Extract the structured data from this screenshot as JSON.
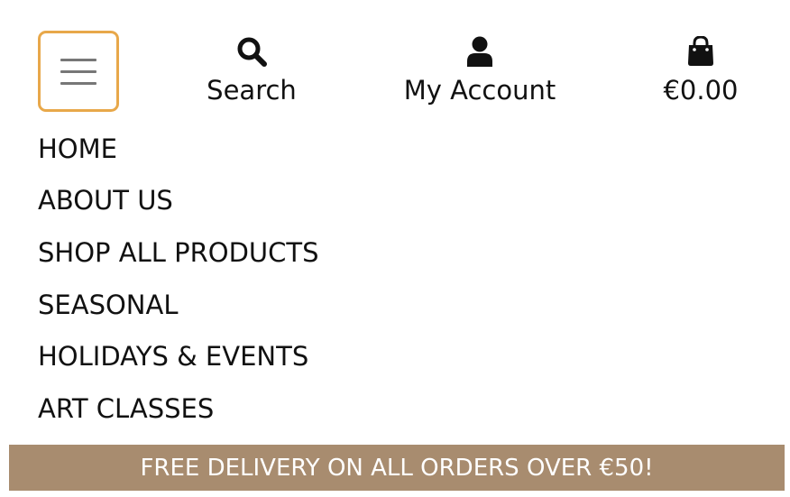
{
  "header": {
    "menu_toggle_icon": "hamburger-icon",
    "accent_color": "#e8a84a",
    "search": {
      "icon": "search-icon",
      "label": "Search"
    },
    "account": {
      "icon": "user-icon",
      "label": "My Account"
    },
    "bag": {
      "icon": "shopping-bag-icon",
      "label": "€0.00"
    }
  },
  "nav": {
    "items": [
      {
        "label": "HOME"
      },
      {
        "label": "ABOUT US"
      },
      {
        "label": "SHOP ALL PRODUCTS"
      },
      {
        "label": "SEASONAL"
      },
      {
        "label": "HOLIDAYS & EVENTS"
      },
      {
        "label": "ART CLASSES"
      }
    ]
  },
  "banner": {
    "text": "FREE DELIVERY ON ALL ORDERS OVER €50!",
    "background_color": "#a88c6f"
  }
}
